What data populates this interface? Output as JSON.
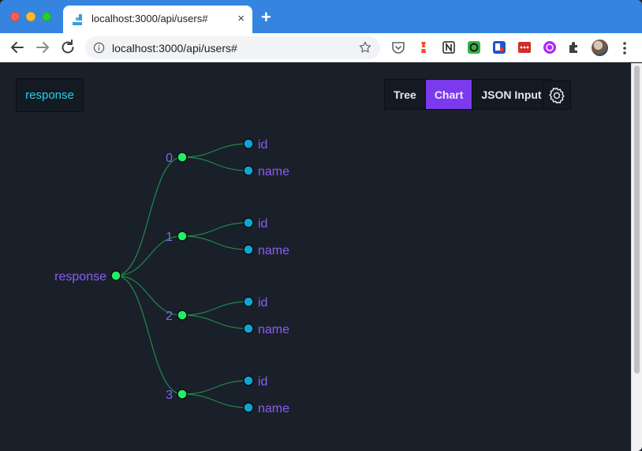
{
  "browser": {
    "tab_title": "localhost:3000/api/users#",
    "tab_close": "×",
    "new_tab": "+",
    "url": "localhost:3000/api/users#"
  },
  "app": {
    "root_label": "response",
    "view_tabs": [
      {
        "label": "Tree",
        "active": false
      },
      {
        "label": "Chart",
        "active": true
      },
      {
        "label": "JSON Input",
        "active": false
      }
    ],
    "settings_icon": "gear-icon"
  },
  "tree": {
    "root": "response",
    "items": [
      {
        "key": "0",
        "fields": [
          "id",
          "name"
        ]
      },
      {
        "key": "1",
        "fields": [
          "id",
          "name"
        ]
      },
      {
        "key": "2",
        "fields": [
          "id",
          "name"
        ]
      },
      {
        "key": "3",
        "fields": [
          "id",
          "name"
        ]
      }
    ]
  },
  "colors": {
    "background": "#1a2029",
    "accent": "#7c3aed",
    "label": "#8b5cf6",
    "branch_node": "#22ee66",
    "leaf_node": "#0ea5d4",
    "link": "#1f8a4c",
    "browser_chrome": "#3585e0"
  }
}
